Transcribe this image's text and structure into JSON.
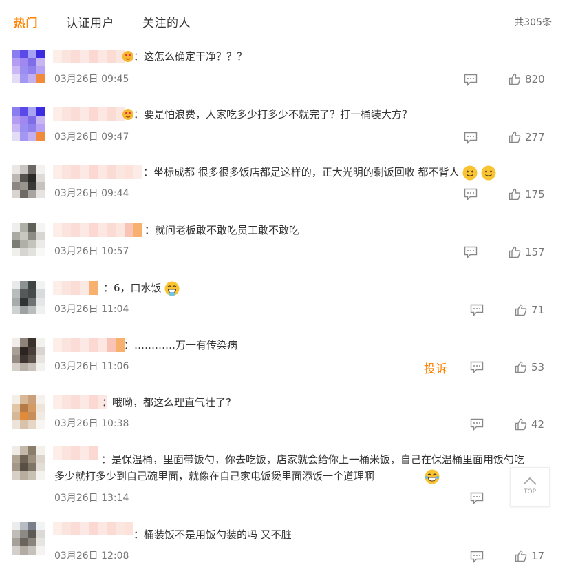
{
  "tabs": [
    {
      "label": "热门",
      "active": true
    },
    {
      "label": "认证用户",
      "active": false
    },
    {
      "label": "关注的人",
      "active": false
    }
  ],
  "total": "共305条",
  "report_label": "投诉",
  "top_button_label": "TOP",
  "accent_color": "#ff8200",
  "comments": [
    {
      "text": "：这怎么确定干净？？？",
      "time": "03月26日 09:45",
      "likes": "820"
    },
    {
      "text": "：要是怕浪费，人家吃多少打多少不就完了？打一桶装大方？",
      "time": "03月26日 09:47",
      "likes": "277"
    },
    {
      "text": "：坐标成都 很多很多饭店都是这样的，正大光明的剩饭回收 都不背人",
      "time": "03月26日 09:44",
      "likes": "175"
    },
    {
      "text": "：就问老板敢不敢吃员工敢不敢吃",
      "time": "03月26日 10:57",
      "likes": "157"
    },
    {
      "text": "：6，口水饭",
      "time": "03月26日 11:04",
      "likes": "71"
    },
    {
      "text": "：…………万一有传染病",
      "time": "03月26日 11:06",
      "likes": "53"
    },
    {
      "text": "：哦呦，都这么理直气壮了?",
      "time": "03月26日 10:38",
      "likes": "42"
    },
    {
      "text": "：是保温桶，里面带饭勺，你去吃饭，店家就会给你上一桶米饭，自己在保温桶里面用饭勺吃多少就打多少到自己碗里面，就像在自己家电饭煲里面添饭一个道理啊",
      "time": "03月26日 13:14",
      "likes": ""
    },
    {
      "text": "：桶装饭不是用饭勺装的吗 又不脏",
      "time": "03月26日 12:08",
      "likes": "17"
    }
  ]
}
